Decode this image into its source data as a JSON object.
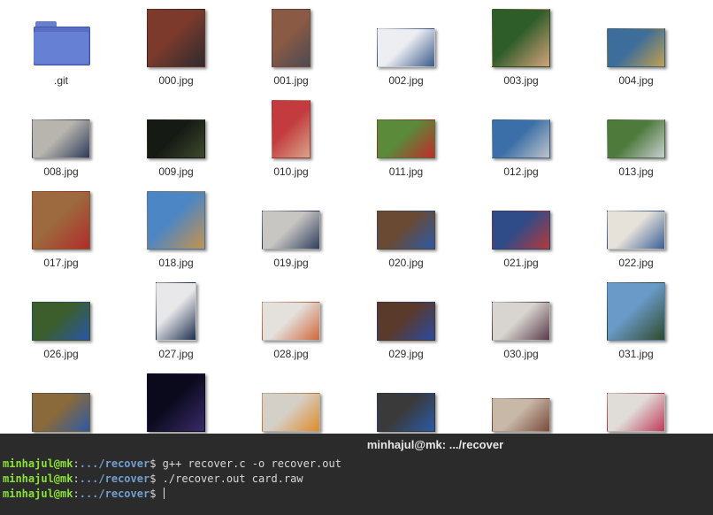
{
  "files": [
    {
      "name": ".git",
      "kind": "folder"
    },
    {
      "name": "000.jpg",
      "kind": "image",
      "colors": [
        "#7b3a2c",
        "#2d2a30"
      ]
    },
    {
      "name": "001.jpg",
      "kind": "image",
      "colors": [
        "#8a5a44",
        "#4b4a55"
      ]
    },
    {
      "name": "002.jpg",
      "kind": "image",
      "colors": [
        "#eceef2",
        "#3a5a8a"
      ]
    },
    {
      "name": "003.jpg",
      "kind": "image",
      "colors": [
        "#2f5d2a",
        "#d6a27a"
      ]
    },
    {
      "name": "004.jpg",
      "kind": "image",
      "colors": [
        "#3d6d9a",
        "#c4a04c"
      ]
    },
    {
      "name": "008.jpg",
      "kind": "image",
      "colors": [
        "#b8b4ae",
        "#2c3b5a"
      ]
    },
    {
      "name": "009.jpg",
      "kind": "image",
      "colors": [
        "#161a14",
        "#3c4a2c"
      ]
    },
    {
      "name": "010.jpg",
      "kind": "image",
      "colors": [
        "#c33b3e",
        "#d9a58a"
      ]
    },
    {
      "name": "011.jpg",
      "kind": "image",
      "colors": [
        "#5a8a3a",
        "#c22a2a"
      ]
    },
    {
      "name": "012.jpg",
      "kind": "image",
      "colors": [
        "#3a6fa8",
        "#c0c4c8"
      ]
    },
    {
      "name": "013.jpg",
      "kind": "image",
      "colors": [
        "#4e7a3c",
        "#c9cfd2"
      ]
    },
    {
      "name": "017.jpg",
      "kind": "image",
      "colors": [
        "#9c6a3e",
        "#b22b2b"
      ]
    },
    {
      "name": "018.jpg",
      "kind": "image",
      "colors": [
        "#4d86c4",
        "#c8934a"
      ]
    },
    {
      "name": "019.jpg",
      "kind": "image",
      "colors": [
        "#c8c6c2",
        "#2e3e5e"
      ]
    },
    {
      "name": "020.jpg",
      "kind": "image",
      "colors": [
        "#6a4a32",
        "#2a5aa8"
      ]
    },
    {
      "name": "021.jpg",
      "kind": "image",
      "colors": [
        "#2f4c88",
        "#b83838"
      ]
    },
    {
      "name": "022.jpg",
      "kind": "image",
      "colors": [
        "#e6e2da",
        "#3a5e96"
      ]
    },
    {
      "name": "026.jpg",
      "kind": "image",
      "colors": [
        "#3b5e2c",
        "#2a56a8"
      ]
    },
    {
      "name": "027.jpg",
      "kind": "image",
      "colors": [
        "#e8e8ea",
        "#1e2e4e"
      ]
    },
    {
      "name": "028.jpg",
      "kind": "image",
      "colors": [
        "#e4e0dc",
        "#d0683a"
      ]
    },
    {
      "name": "029.jpg",
      "kind": "image",
      "colors": [
        "#5a3a2a",
        "#2a4aa0"
      ]
    },
    {
      "name": "030.jpg",
      "kind": "image",
      "colors": [
        "#d8d4d0",
        "#5a3a4a"
      ]
    },
    {
      "name": "031.jpg",
      "kind": "image",
      "colors": [
        "#6a9ac8",
        "#2e4a2a"
      ]
    },
    {
      "name": "",
      "kind": "image",
      "colors": [
        "#8a6a3a",
        "#2a5aa8"
      ]
    },
    {
      "name": "",
      "kind": "image",
      "colors": [
        "#0a0a1c",
        "#3a2a6a"
      ]
    },
    {
      "name": "",
      "kind": "image",
      "colors": [
        "#d4d0c8",
        "#e08a2a"
      ]
    },
    {
      "name": "",
      "kind": "image",
      "colors": [
        "#3a3a3a",
        "#2a5aa8"
      ]
    },
    {
      "name": "",
      "kind": "image",
      "colors": [
        "#c8b8a8",
        "#7a4a3a"
      ]
    },
    {
      "name": "",
      "kind": "image",
      "colors": [
        "#e0dcd8",
        "#c03a5a"
      ]
    }
  ],
  "terminal": {
    "title": "minhajul@mk: .../recover",
    "lines": [
      {
        "user": "minhajul@mk",
        "sep": ":",
        "path": ".../recover",
        "prompt": "$",
        "command": " g++ recover.c -o recover.out"
      },
      {
        "user": "minhajul@mk",
        "sep": ":",
        "path": ".../recover",
        "prompt": "$",
        "command": " ./recover.out card.raw"
      },
      {
        "user": "minhajul@mk",
        "sep": ":",
        "path": ".../recover",
        "prompt": "$",
        "command": " "
      }
    ]
  }
}
